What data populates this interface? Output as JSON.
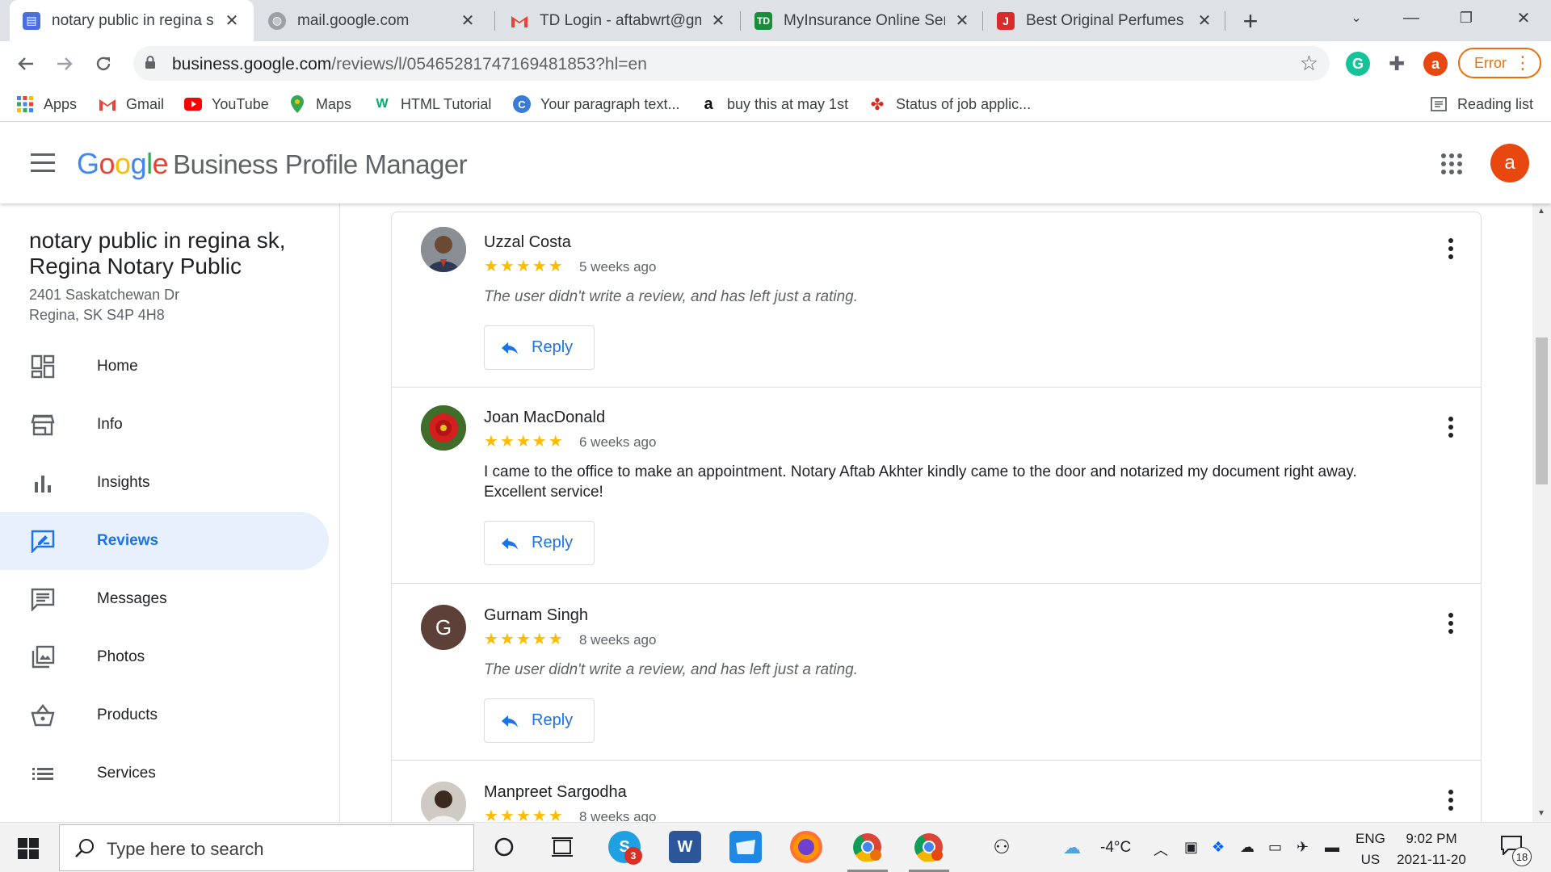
{
  "browser": {
    "tabs": [
      {
        "title": "notary public in regina sk, ",
        "active": true,
        "icon": "business-profile-icon"
      },
      {
        "title": "mail.google.com",
        "active": false,
        "icon": "globe-icon"
      },
      {
        "title": "TD Login - aftabwrt@gma",
        "active": false,
        "icon": "gmail-icon"
      },
      {
        "title": "MyInsurance Online Servi",
        "active": false,
        "icon": "td-icon"
      },
      {
        "title": "Best Original Perfumes &",
        "active": false,
        "icon": "perfume-j-icon"
      }
    ],
    "new_tab": "+",
    "url_host": "business.google.com",
    "url_path": "/reviews/l/05465281747169481853?hl=en",
    "profile_initial": "a",
    "error_label": "Error",
    "bookmarks": [
      {
        "label": "Apps",
        "icon": "apps-grid-icon"
      },
      {
        "label": "Gmail",
        "icon": "gmail-icon"
      },
      {
        "label": "YouTube",
        "icon": "youtube-icon"
      },
      {
        "label": "Maps",
        "icon": "maps-pin-icon"
      },
      {
        "label": "HTML Tutorial",
        "icon": "w3schools-icon"
      },
      {
        "label": "Your paragraph text...",
        "icon": "canva-icon"
      },
      {
        "label": "buy this at may 1st",
        "icon": "amazon-icon"
      },
      {
        "label": "Status of job applic...",
        "icon": "maple-leaf-icon"
      }
    ],
    "reading_list": "Reading list"
  },
  "app": {
    "logo_google": "Google",
    "product": "Business Profile Manager",
    "user_initial": "a"
  },
  "business": {
    "name": "notary public in regina sk, Regina Notary Public",
    "address_line1": "2401 Saskatchewan Dr",
    "address_line2": "Regina, SK S4P 4H8"
  },
  "nav": [
    {
      "label": "Home",
      "icon": "dashboard-icon",
      "active": false
    },
    {
      "label": "Info",
      "icon": "storefront-icon",
      "active": false
    },
    {
      "label": "Insights",
      "icon": "bar-chart-icon",
      "active": false
    },
    {
      "label": "Reviews",
      "icon": "rate-review-icon",
      "active": true
    },
    {
      "label": "Messages",
      "icon": "message-icon",
      "active": false
    },
    {
      "label": "Photos",
      "icon": "photo-library-icon",
      "active": false
    },
    {
      "label": "Products",
      "icon": "shopping-basket-icon",
      "active": false
    },
    {
      "label": "Services",
      "icon": "list-icon",
      "active": false
    }
  ],
  "reviews": [
    {
      "name": "Uzzal Costa",
      "stars": "★★★★★",
      "time": "5 weeks ago",
      "text": "The user didn't write a review, and has left just a rating.",
      "rating_only": true,
      "reply": "Reply",
      "avatar": "photo-portrait"
    },
    {
      "name": "Joan MacDonald",
      "stars": "★★★★★",
      "time": "6 weeks ago",
      "text": "I came to the office to make an appointment. Notary Aftab Akhter kindly came to the door and notarized my document right away. Excellent service!",
      "rating_only": false,
      "reply": "Reply",
      "avatar": "photo-flower"
    },
    {
      "name": "Gurnam Singh",
      "stars": "★★★★★",
      "time": "8 weeks ago",
      "text": "The user didn't write a review, and has left just a rating.",
      "rating_only": true,
      "reply": "Reply",
      "avatar_letter": "G"
    },
    {
      "name": "Manpreet Sargodha",
      "stars": "★★★★★",
      "time": "8 weeks ago",
      "avatar": "photo-portrait"
    }
  ],
  "taskbar": {
    "search_placeholder": "Type here to search",
    "skype_badge": "3",
    "temperature": "-4°C",
    "lang_line1": "ENG",
    "lang_line2": "US",
    "time": "9:02 PM",
    "date": "2021-11-20",
    "notification_count": "18"
  },
  "colors": {
    "accent": "#1a73e8",
    "star": "#fbbc04",
    "active_nav_bg": "#e8f0fe",
    "profile_avatar": "#e8470f"
  }
}
